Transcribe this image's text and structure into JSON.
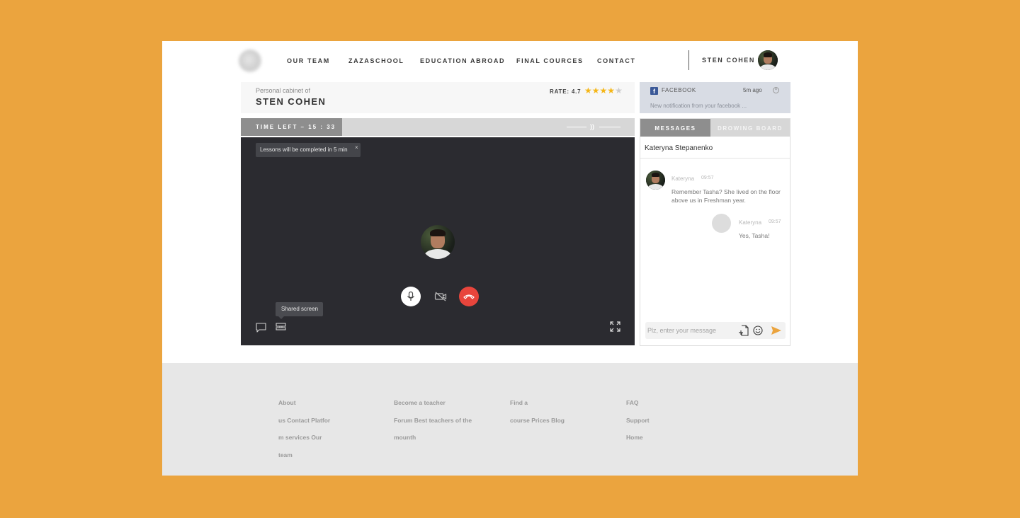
{
  "header": {
    "nav": [
      "OUR TEAM",
      "ZAZASCHOOL",
      "EDUCATION ABROAD",
      "FINAL COURCES",
      "CONTACT"
    ],
    "user_name": "STEN COHEN"
  },
  "cabinet": {
    "subtitle": "Personal cabinet of",
    "name": "STEN COHEN",
    "rate_label": "RATE: 4.7",
    "rating": 4.7,
    "stars_filled": 4,
    "stars_total": 5
  },
  "session": {
    "time_left": "TIME LEFT – 15 : 33",
    "volume_knob": "))",
    "toast": "Lessons will be completed in 5 min",
    "toast_close": "×",
    "tooltip": "Shared screen"
  },
  "notification": {
    "source": "FACEBOOK",
    "fb_glyph": "f",
    "time": "5m ago",
    "close": "×",
    "message": "New notification from your facebook ..."
  },
  "chat": {
    "tabs": [
      "MESSAGES",
      "DROWING BOARD"
    ],
    "active_tab": "MESSAGES",
    "contact": "Kateryna Stepanenko",
    "messages": [
      {
        "author": "Kateryna",
        "time": "09:57",
        "text": "Remember Tasha? She lived on the floor above us in Freshman year."
      },
      {
        "author": "Kateryna",
        "time": "09:57",
        "text": "Yes, Tasha!"
      }
    ],
    "input_placeholder": "Plz, enter your message"
  },
  "footer": {
    "col1": [
      "About",
      "us  Contact  Platfor",
      "m services  Our",
      "team"
    ],
    "col2": [
      "Become a teacher",
      "Forum  Best teachers of the",
      "mounth"
    ],
    "col3": [
      "Find a",
      "course  Prices  Blog"
    ],
    "col4": [
      "FAQ",
      "Support",
      "Home"
    ]
  },
  "colors": {
    "background": "#EBA43E",
    "star": "#F5B617",
    "end_call": "#E8453C",
    "send": "#EBA43E",
    "video_bg": "#2B2B30"
  }
}
